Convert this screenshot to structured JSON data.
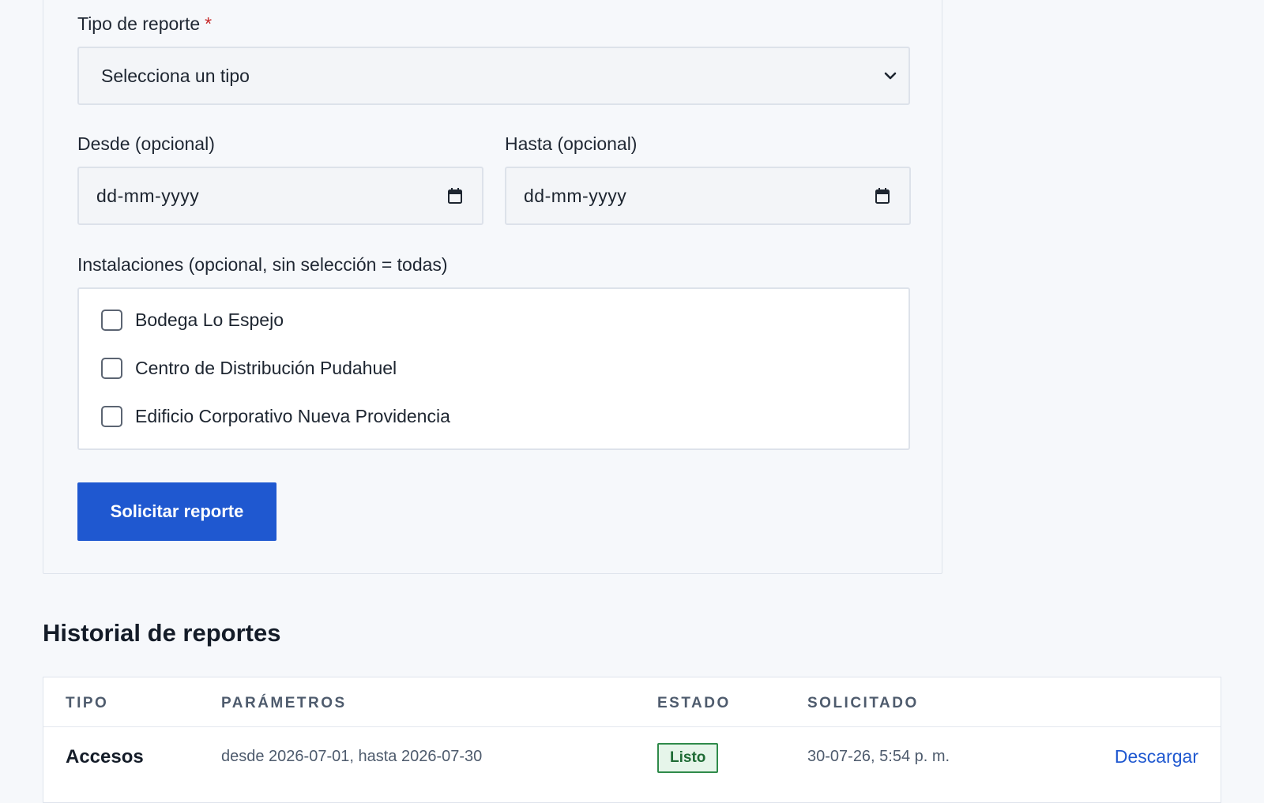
{
  "form": {
    "report_type": {
      "label": "Tipo de reporte",
      "required_mark": "*",
      "selected": "Selecciona un tipo"
    },
    "from_date": {
      "label": "Desde (opcional)",
      "placeholder": "dd-mm-yyyy"
    },
    "to_date": {
      "label": "Hasta (opcional)",
      "placeholder": "dd-mm-yyyy"
    },
    "facilities": {
      "label": "Instalaciones (opcional, sin selección = todas)",
      "options": [
        {
          "label": "Bodega Lo Espejo",
          "checked": false
        },
        {
          "label": "Centro de Distribución Pudahuel",
          "checked": false
        },
        {
          "label": "Edificio Corporativo Nueva Providencia",
          "checked": false
        }
      ]
    },
    "submit_label": "Solicitar reporte"
  },
  "history": {
    "title": "Historial de reportes",
    "columns": [
      "TIPO",
      "PARÁMETROS",
      "ESTADO",
      "SOLICITADO"
    ],
    "rows": [
      {
        "type": "Accesos",
        "params": "desde 2026-07-01, hasta 2026-07-30",
        "status": "Listo",
        "requested": "30-07-26, 5:54 p. m.",
        "action": "Descargar"
      }
    ]
  },
  "colors": {
    "primary": "#1f58d0",
    "required": "#c62828",
    "status_ready_bg": "#e6f5ea",
    "status_ready_border": "#2f8a4a"
  },
  "icons": [
    "chevron-down-icon",
    "calendar-icon"
  ]
}
